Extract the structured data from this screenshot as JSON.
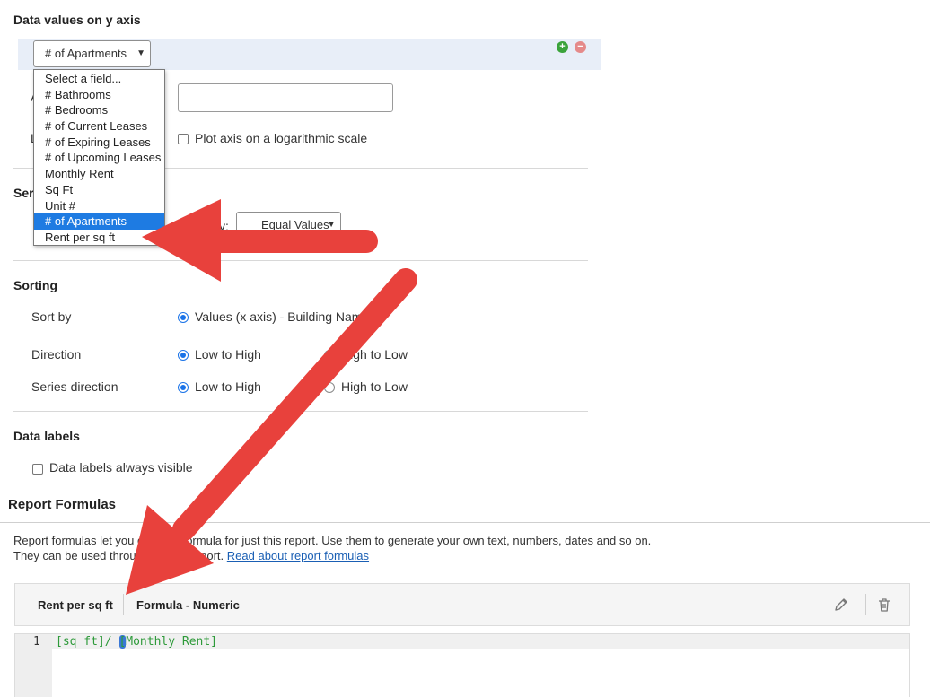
{
  "yaxis": {
    "title": "Data values on y axis",
    "selected_field": "# of Apartments",
    "options": [
      "Select a field...",
      "# Bathrooms",
      "# Bedrooms",
      "# of Current Leases",
      "# of Expiring Leases",
      "# of Upcoming Leases",
      "Monthly Rent",
      "Sq Ft",
      "Unit #",
      "# of Apartments",
      "Rent per sq ft"
    ],
    "selected_index": 9,
    "add_symbol": "+",
    "remove_symbol": "−",
    "partial_label_a": "A",
    "partial_label_l": "L",
    "log_scale_label": "Plot axis on a logarithmic scale"
  },
  "series": {
    "partial_title": "Seri",
    "partial_label_tail": "y:",
    "select_value": "Equal Values"
  },
  "sorting": {
    "title": "Sorting",
    "sort_by_label": "Sort by",
    "sort_by_value": "Values (x axis) - Building Name",
    "direction_label": "Direction",
    "direction_low": "Low to High",
    "direction_high": "High to Low",
    "series_direction_label": "Series direction",
    "series_low": "Low to High",
    "series_high": "High to Low"
  },
  "data_labels": {
    "title": "Data labels",
    "always_visible": "Data labels always visible"
  },
  "report_formulas": {
    "title": "Report Formulas",
    "desc_line1": "Report formulas let you create a formula for just this report. Use them to generate your own text, numbers, dates and so on.",
    "desc_line2": "They can be used throughout this report.",
    "link": "Read about report formulas",
    "formula_name": "Rent per sq ft",
    "formula_type": "Formula - Numeric",
    "line_number": "1",
    "code": "[sq ft]/ [Monthly Rent]"
  },
  "icons": {
    "edit": "pencil-icon",
    "delete": "trash-icon"
  },
  "colors": {
    "arrow": "#e8413c",
    "selected": "#1e7be2",
    "code": "#2e9a3a"
  }
}
